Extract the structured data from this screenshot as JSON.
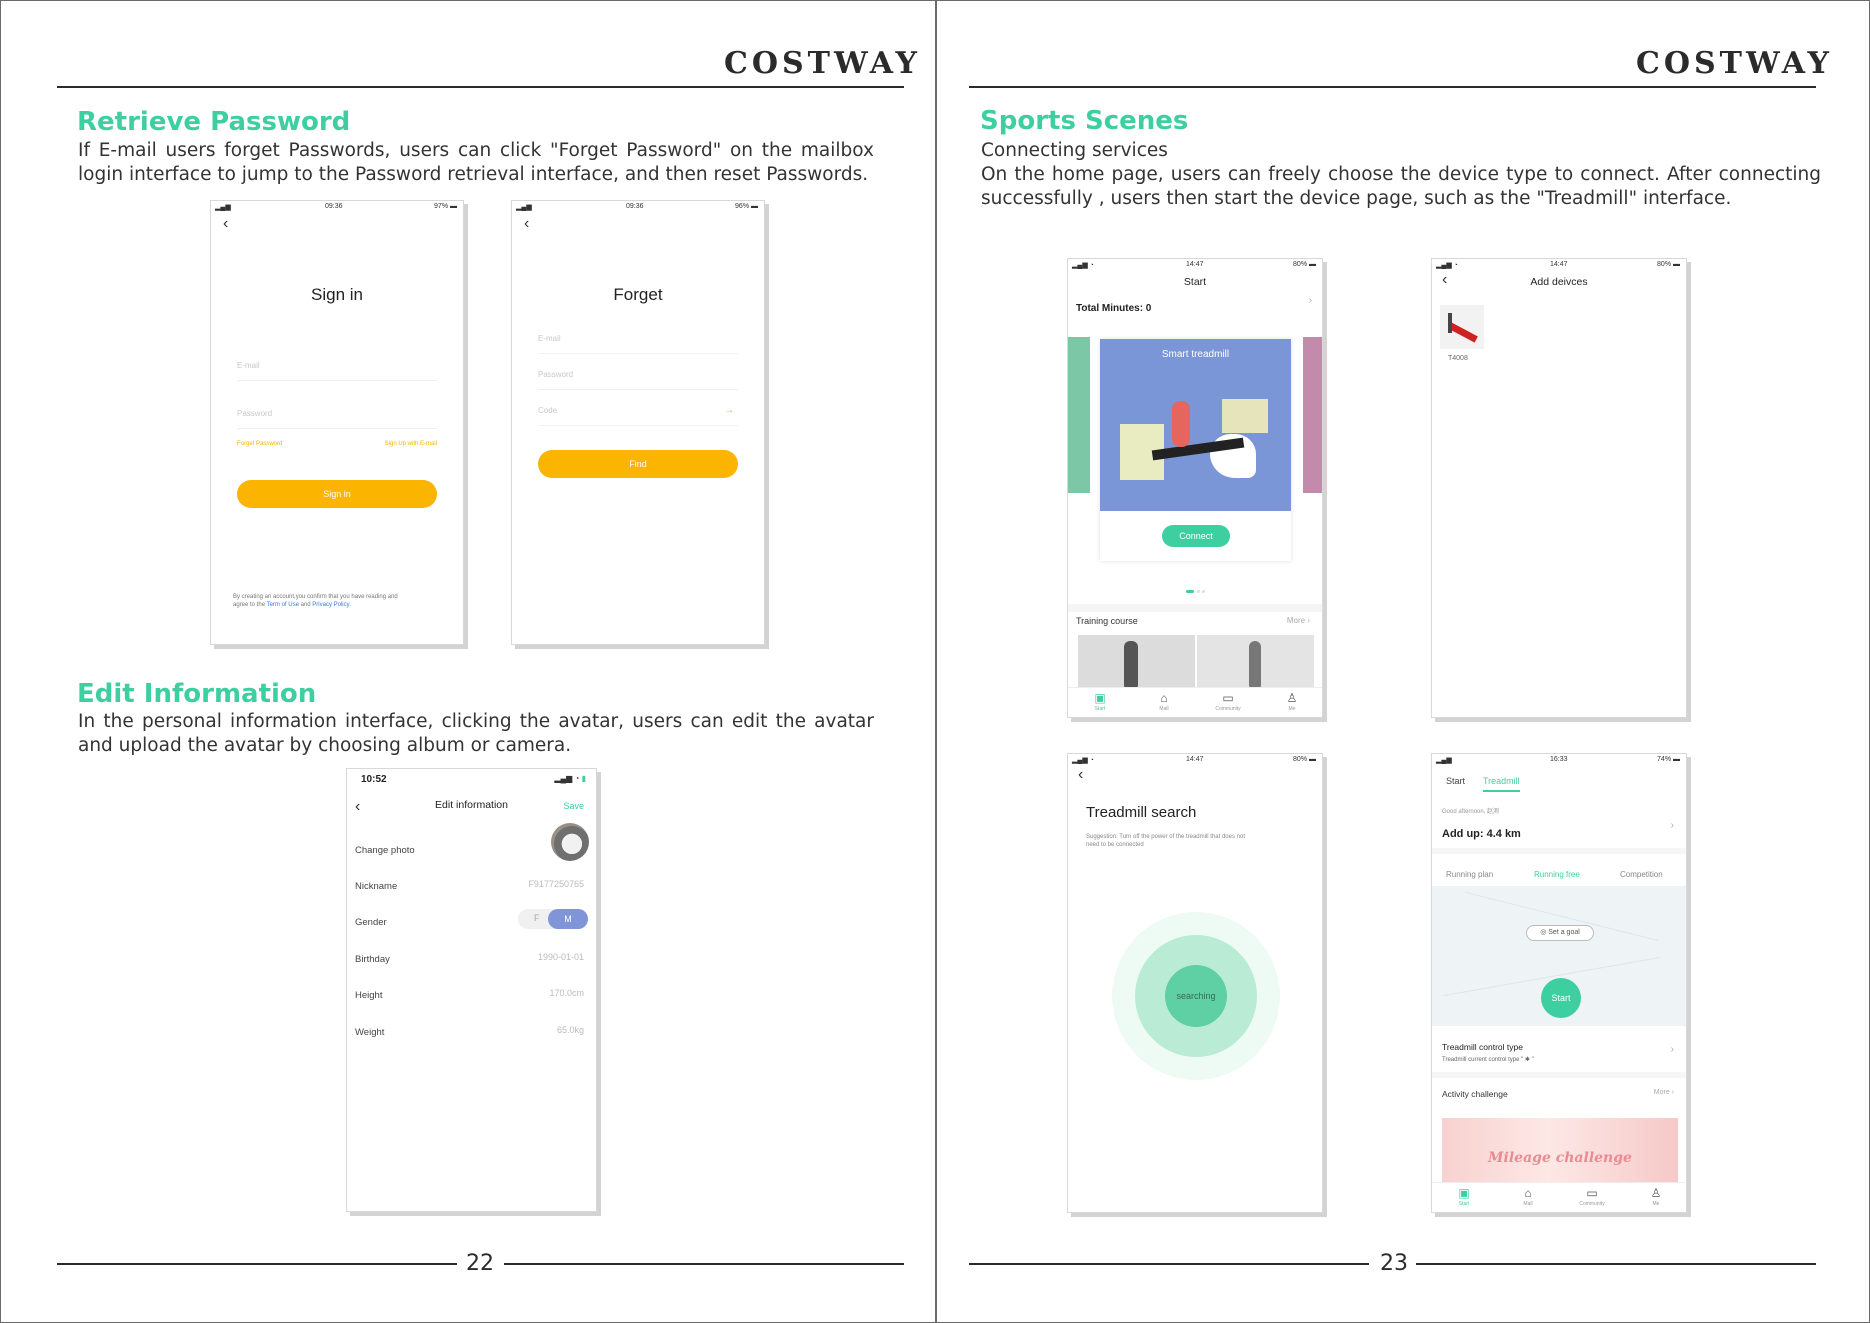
{
  "brand": "COSTWAY",
  "left_page": {
    "number": "22",
    "retrieve": {
      "heading": "Retrieve Password",
      "text": "If E-mail users forget Passwords, users can click \"Forget Password\" on the mailbox login interface to jump to the Password retrieval interface, and then reset Passwords."
    },
    "signin_screen": {
      "time": "09:36",
      "battery": "97%",
      "title": "Sign in",
      "email_placeholder": "E-mail",
      "password_placeholder": "Password",
      "forget_link": "Forget Password",
      "signup_link": "Sign Up with E-mail",
      "button": "Sign in",
      "terms_line1": "By creating an account,you confirm that you have reading and",
      "terms_line2_a": "agree to the ",
      "terms_link1": "Term of Use",
      "terms_and": " and ",
      "terms_link2": "Privacy Policy",
      "terms_end": "."
    },
    "forget_screen": {
      "time": "09:36",
      "battery": "96%",
      "title": "Forget",
      "email_placeholder": "E-mail",
      "password_placeholder": "Password",
      "code_placeholder": "Code",
      "button": "Find"
    },
    "edit": {
      "heading": "Edit Information",
      "text": "In the personal information interface, clicking the avatar, users can edit the avatar and upload the avatar by choosing album or camera."
    },
    "edit_screen": {
      "time": "10:52",
      "title": "Edit information",
      "save": "Save",
      "change_photo": "Change photo",
      "nickname_label": "Nickname",
      "nickname_value": "F9177250765",
      "gender_label": "Gender",
      "gender_f": "F",
      "gender_m": "M",
      "birthday_label": "Birthday",
      "birthday_value": "1990-01-01",
      "height_label": "Height",
      "height_value": "170.0cm",
      "weight_label": "Weight",
      "weight_value": "65.0kg"
    }
  },
  "right_page": {
    "number": "23",
    "sports": {
      "heading": "Sports Scenes",
      "subheading": "Connecting services",
      "text": "On the home page, users can freely choose the device type to connect. After connecting successfully , users then start the device page, such as the \"Treadmill\" interface."
    },
    "start_screen": {
      "time": "14:47",
      "battery": "80%",
      "title": "Start",
      "total": "Total Minutes: 0",
      "card_title": "Smart treadmill",
      "connect": "Connect",
      "training": "Training course",
      "more": "More",
      "tabs": [
        "Start",
        "Mall",
        "Community",
        "Me"
      ]
    },
    "add_screen": {
      "time": "14:47",
      "battery": "80%",
      "title": "Add deivces",
      "device": "T4008"
    },
    "search_screen": {
      "time": "14:47",
      "battery": "80%",
      "title": "Treadmill search",
      "suggestion_l1": "Suggestion: Turn off the power of the treadmill that does not",
      "suggestion_l2": "need to be connected",
      "searching": "searching"
    },
    "treadmill_screen": {
      "time": "16:33",
      "battery": "74%",
      "tab_start": "Start",
      "tab_treadmill": "Treadmill",
      "greeting": "Good afternoon, 赵测",
      "addup": "Add up: 4.4 km",
      "mode_plan": "Running plan",
      "mode_free": "Running free",
      "mode_comp": "Competition",
      "goal": "Set a goal",
      "start": "Start",
      "control_title": "Treadmill control type",
      "control_sub": "Treadmill current control type \" ✱ \"",
      "activity": "Activity challenge",
      "more": "More",
      "banner": "Mileage challenge",
      "tabs": [
        "Start",
        "Mall",
        "Community",
        "Me"
      ]
    }
  },
  "colors": {
    "accent": "#3ecfa0",
    "yellow": "#fbb400",
    "card_blue": "#7b96d6",
    "toggle": "#7f95d8"
  }
}
